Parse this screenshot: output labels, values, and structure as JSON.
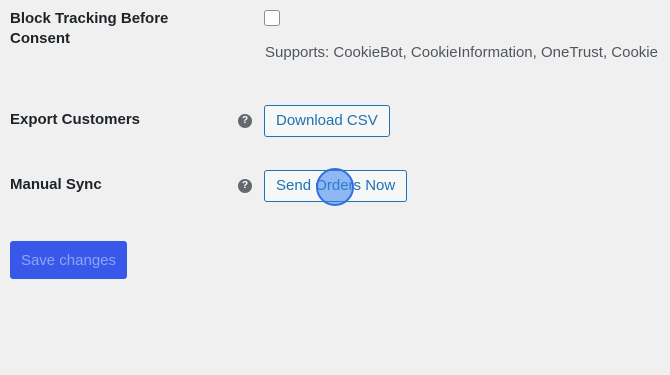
{
  "rows": {
    "block_tracking": {
      "label": "Block Tracking Before Consent",
      "checked": false,
      "description": "Supports: CookieBot, CookieInformation, OneTrust, Cookie"
    },
    "export_customers": {
      "label": "Export Customers",
      "help_icon": "?",
      "button_label": "Download CSV"
    },
    "manual_sync": {
      "label": "Manual Sync",
      "help_icon": "?",
      "button_label": "Send Orders Now"
    }
  },
  "save_button_label": "Save changes",
  "colors": {
    "primary": "#3858e9",
    "link": "#2271b1",
    "background": "#f0f0f1"
  }
}
